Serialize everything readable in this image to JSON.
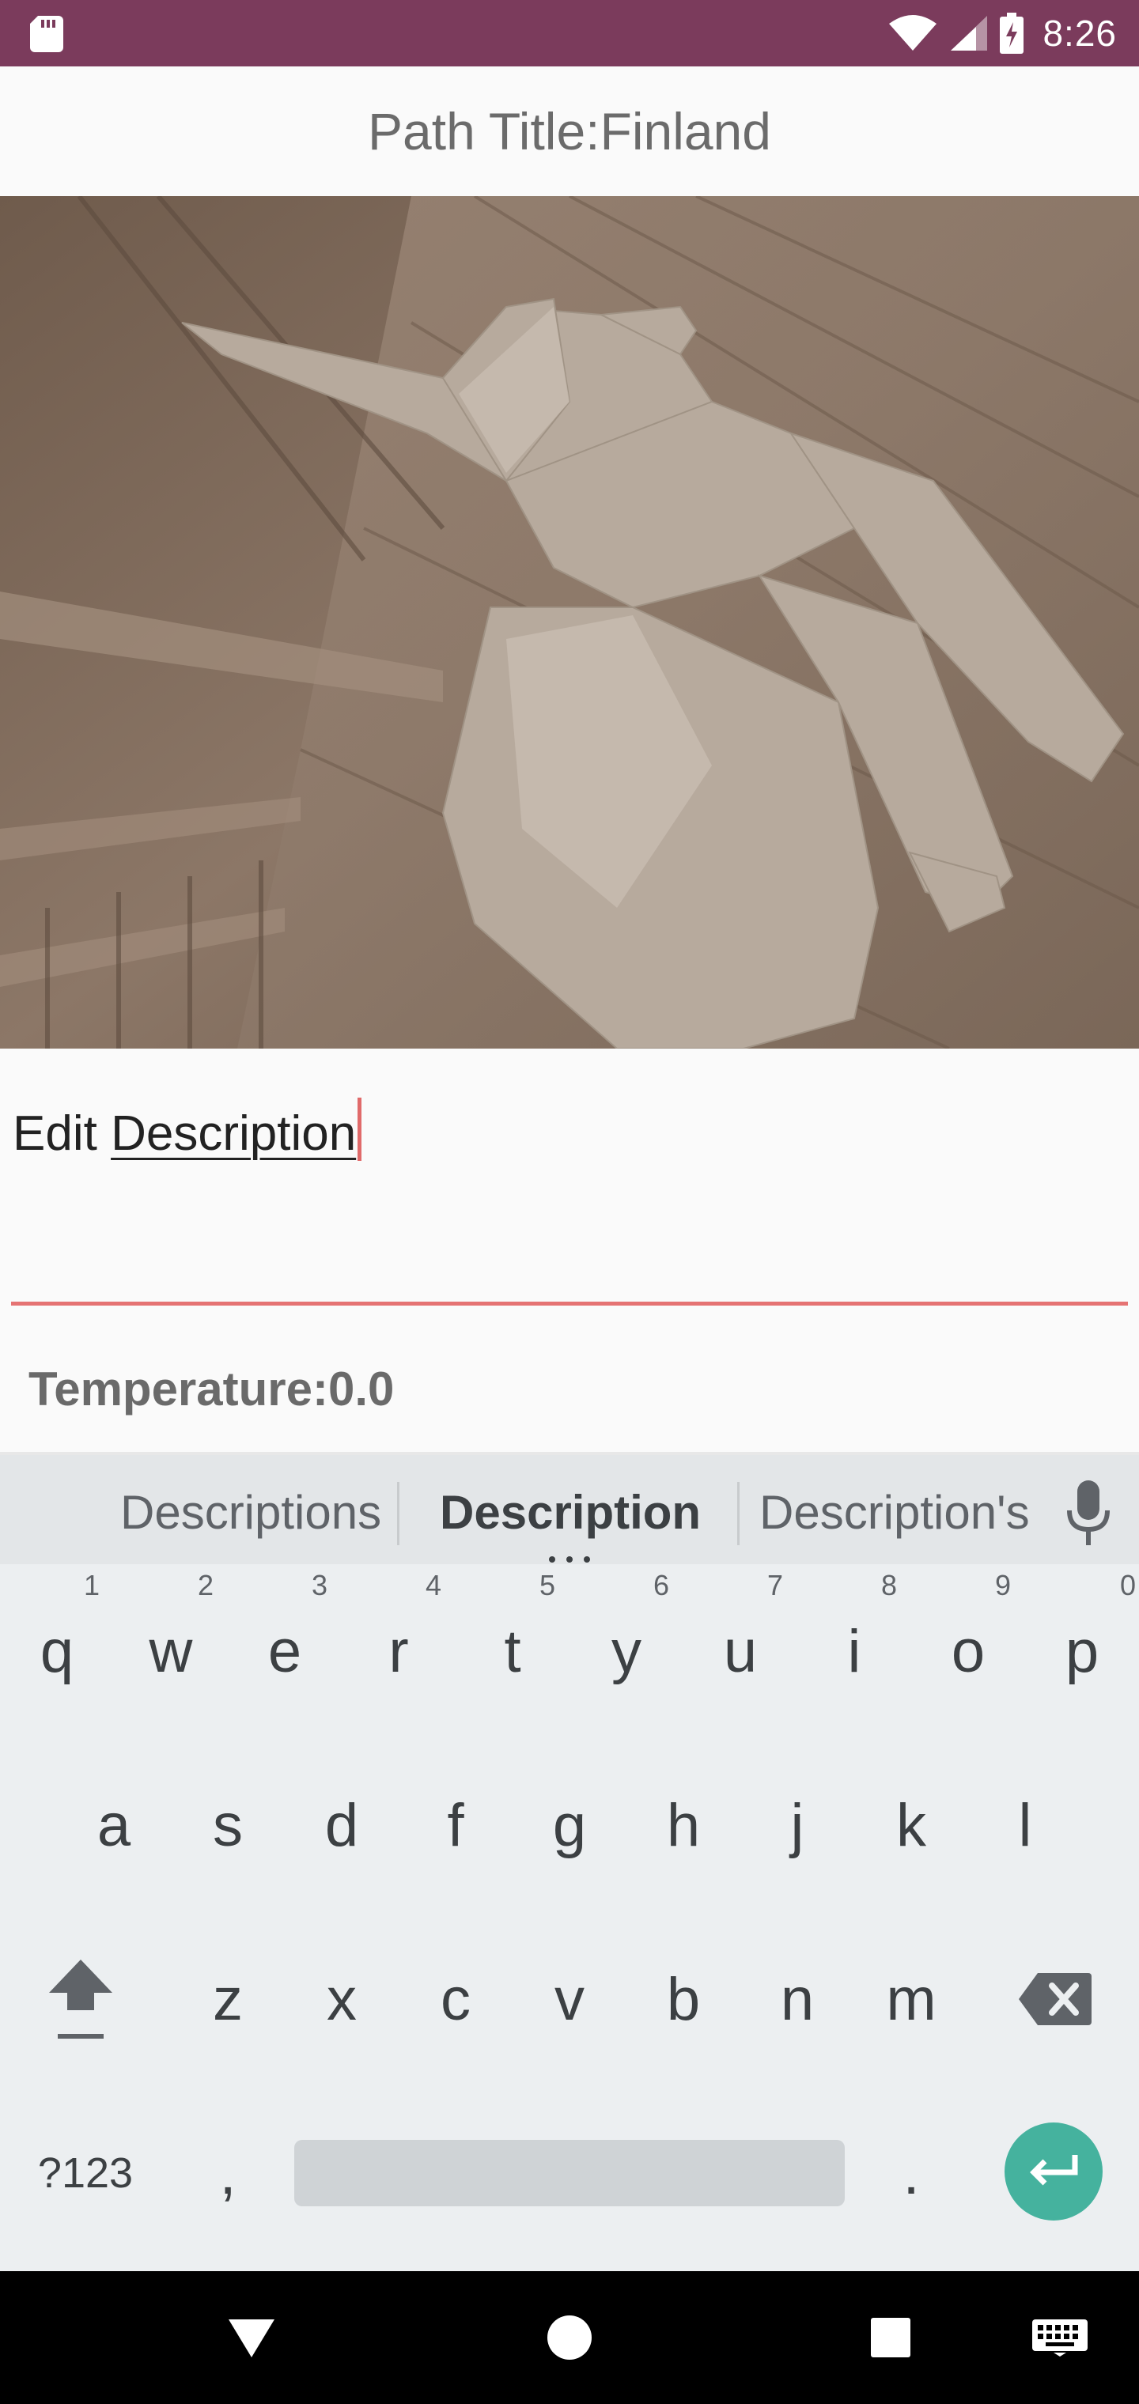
{
  "status_bar": {
    "time": "8:26"
  },
  "app_bar": {
    "title": "Path Title:Finland"
  },
  "description": {
    "prefix": "Edit ",
    "word": "Description"
  },
  "temperature": {
    "label": "Temperature:0.0"
  },
  "keyboard": {
    "suggestions": [
      "Descriptions",
      "Description",
      "Description's"
    ],
    "row1": [
      {
        "key": "q",
        "hint": "1"
      },
      {
        "key": "w",
        "hint": "2"
      },
      {
        "key": "e",
        "hint": "3"
      },
      {
        "key": "r",
        "hint": "4"
      },
      {
        "key": "t",
        "hint": "5"
      },
      {
        "key": "y",
        "hint": "6"
      },
      {
        "key": "u",
        "hint": "7"
      },
      {
        "key": "i",
        "hint": "8"
      },
      {
        "key": "o",
        "hint": "9"
      },
      {
        "key": "p",
        "hint": "0"
      }
    ],
    "row2": [
      "a",
      "s",
      "d",
      "f",
      "g",
      "h",
      "j",
      "k",
      "l"
    ],
    "row3": [
      "z",
      "x",
      "c",
      "v",
      "b",
      "n",
      "m"
    ],
    "symbols_label": "?123",
    "comma": ",",
    "period": "."
  }
}
